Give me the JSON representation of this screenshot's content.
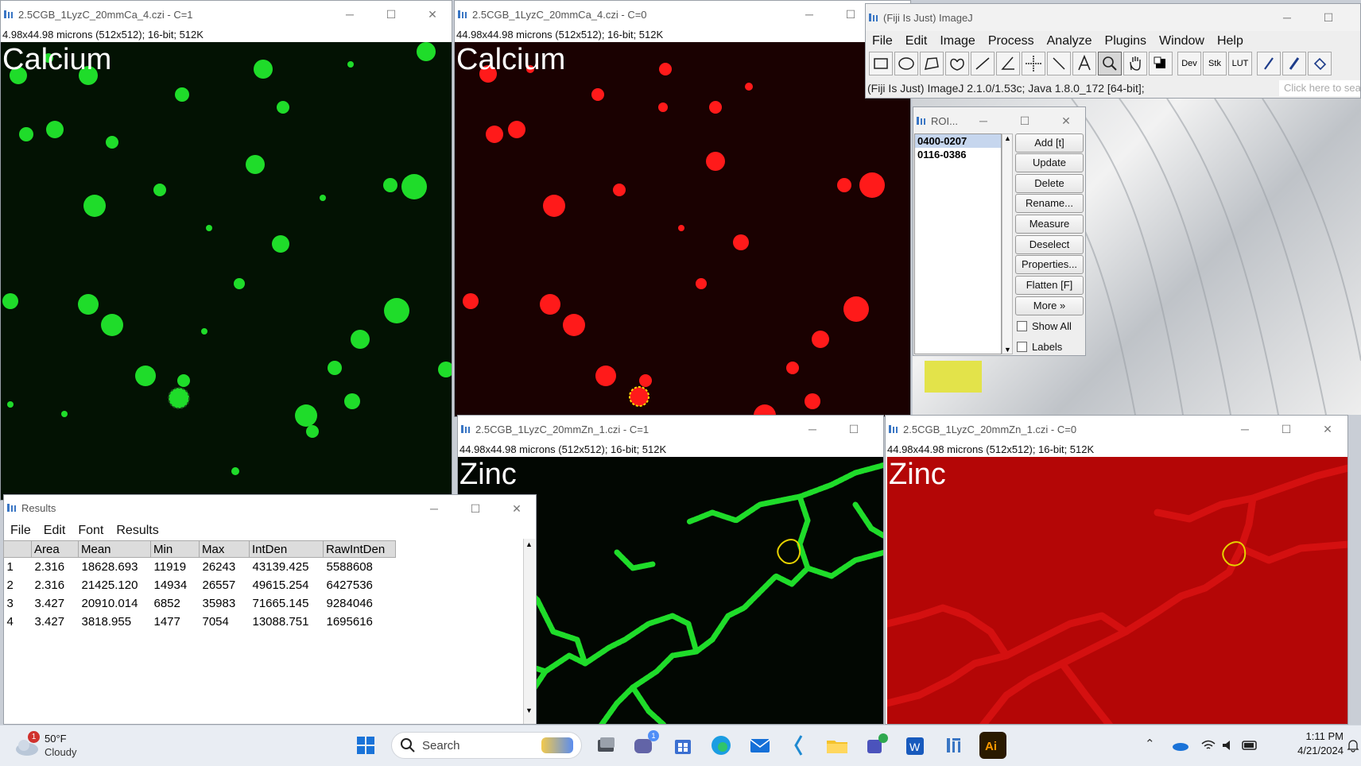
{
  "windows": {
    "ca_green": {
      "title": "2.5CGB_1LyzC_20mmCa_4.czi - C=1",
      "subtitle": "4.98x44.98 microns (512x512); 16-bit; 512K",
      "label": "Calcium"
    },
    "ca_red": {
      "title": "2.5CGB_1LyzC_20mmCa_4.czi - C=0",
      "subtitle": "44.98x44.98 microns (512x512); 16-bit; 512K",
      "label": "Calcium"
    },
    "zn_green": {
      "title": "2.5CGB_1LyzC_20mmZn_1.czi - C=1",
      "subtitle": "44.98x44.98 microns (512x512); 16-bit; 512K",
      "label": "Zinc"
    },
    "zn_red": {
      "title": "2.5CGB_1LyzC_20mmZn_1.czi - C=0",
      "subtitle": "44.98x44.98 microns (512x512); 16-bit; 512K",
      "label": "Zinc"
    }
  },
  "imagej": {
    "title": "(Fiji Is Just) ImageJ",
    "menu": [
      "File",
      "Edit",
      "Image",
      "Process",
      "Analyze",
      "Plugins",
      "Window",
      "Help"
    ],
    "tools": [
      "rectangle-tool-icon",
      "oval-tool-icon",
      "polygon-tool-icon",
      "freehand-tool-icon",
      "line-tool-icon",
      "angle-tool-icon",
      "point-tool-icon",
      "wand-tool-icon",
      "text-tool-icon",
      "magnifier-tool-icon",
      "hand-tool-icon",
      "color-picker-icon"
    ],
    "dev_label": "Dev",
    "stk_label": "Stk",
    "lut_label": "LUT",
    "status": "(Fiji Is Just) ImageJ 2.1.0/1.53c; Java 1.8.0_172 [64-bit];",
    "search_placeholder": "Click here to sea"
  },
  "roi_manager": {
    "title": "ROI...",
    "items": [
      "0400-0207",
      "0116-0386"
    ],
    "buttons": [
      "Add [t]",
      "Update",
      "Delete",
      "Rename...",
      "Measure",
      "Deselect",
      "Properties...",
      "Flatten [F]",
      "More »"
    ],
    "show_all": "Show All",
    "labels": "Labels"
  },
  "results": {
    "title": "Results",
    "menu": [
      "File",
      "Edit",
      "Font",
      "Results"
    ],
    "columns": [
      "",
      "Area",
      "Mean",
      "Min",
      "Max",
      "IntDen",
      "RawIntDen"
    ],
    "rows": [
      [
        "1",
        "2.316",
        "18628.693",
        "11919",
        "26243",
        "43139.425",
        "5588608"
      ],
      [
        "2",
        "2.316",
        "21425.120",
        "14934",
        "26557",
        "49615.254",
        "6427536"
      ],
      [
        "3",
        "3.427",
        "20910.014",
        "6852",
        "35983",
        "71665.145",
        "9284046"
      ],
      [
        "4",
        "3.427",
        "3818.955",
        "1477",
        "7054",
        "13088.751",
        "1695616"
      ]
    ]
  },
  "taskbar": {
    "weather_temp": "50°F",
    "weather_desc": "Cloudy",
    "weather_badge": "1",
    "search_label": "Search",
    "teams_badge": "1",
    "time": "1:11 PM",
    "date": "4/21/2024"
  },
  "colors": {
    "green": "#1fdc2a",
    "red": "#ff1a1a",
    "ca_bg_green": "#031203",
    "ca_bg_red": "#1a0101"
  }
}
